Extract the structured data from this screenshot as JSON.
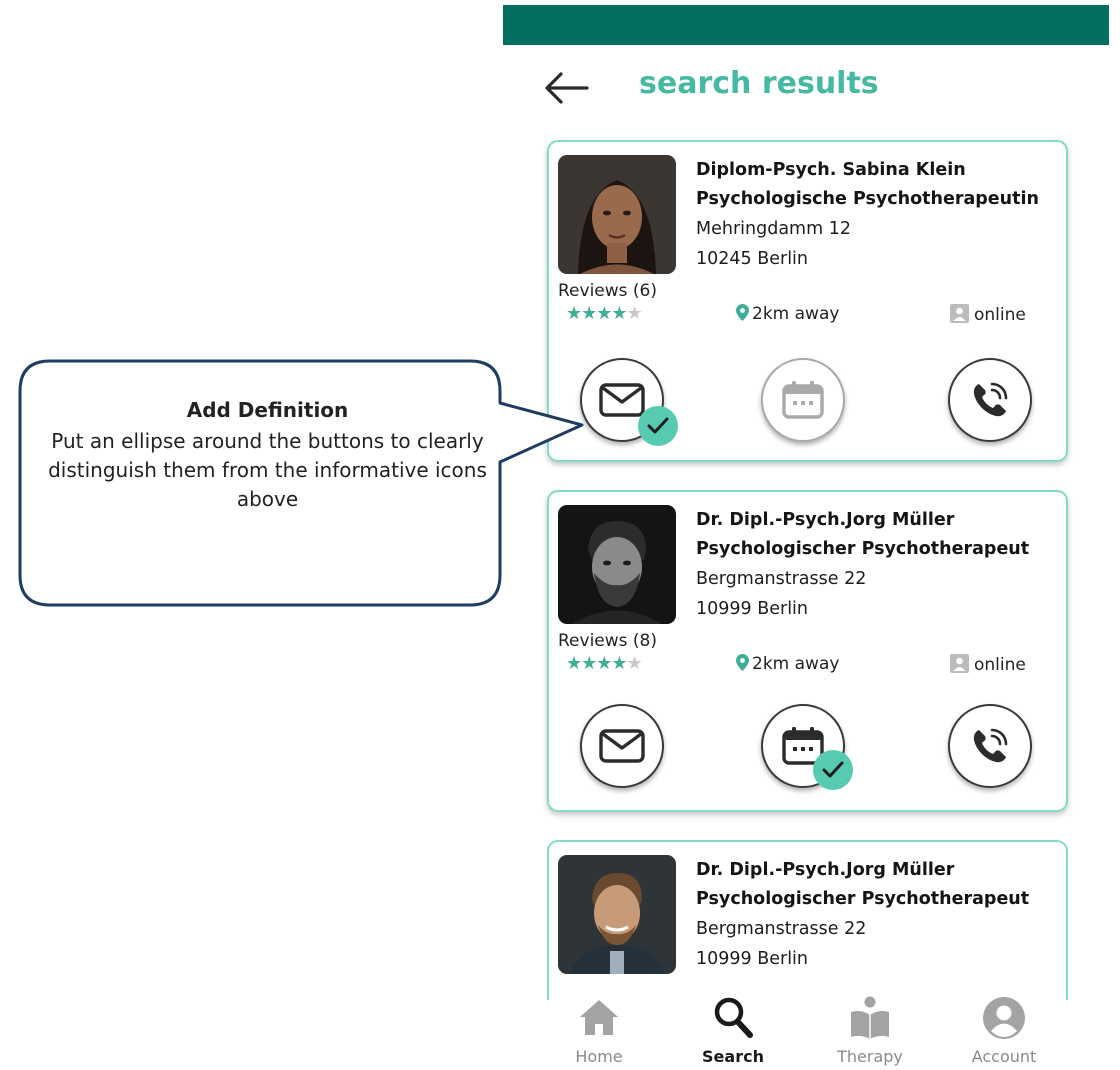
{
  "header": {
    "title": "search results"
  },
  "callout": {
    "heading": "Add Definition",
    "body": "Put an ellipse around the buttons to clearly distinguish them from the informative icons above"
  },
  "results": [
    {
      "name": "Diplom-Psych. Sabina Klein",
      "role": "Psychologische Psychotherapeutin",
      "street": "Mehringdamm 12",
      "city": "10245 Berlin",
      "reviews": "Reviews (6)",
      "rating": 4,
      "distance": "2km away",
      "availability": "online"
    },
    {
      "name": "Dr. Dipl.-Psych.Jorg Müller",
      "role": "Psychologischer Psychotherapeut",
      "street": "Bergmanstrasse 22",
      "city": "10999 Berlin",
      "reviews": "Reviews (8)",
      "rating": 4,
      "distance": "2km away",
      "availability": "online"
    },
    {
      "name": "Dr. Dipl.-Psych.Jorg Müller",
      "role": "Psychologischer Psychotherapeut",
      "street": "Bergmanstrasse 22",
      "city": "10999 Berlin"
    }
  ],
  "nav": {
    "home": "Home",
    "search": "Search",
    "therapy": "Therapy",
    "account": "Account"
  },
  "colors": {
    "topbar": "#016f5d",
    "accent": "#46b9a2",
    "card_border": "#7fdcc7",
    "check": "#56cbb1",
    "callout_border": "#1f3d63"
  },
  "icons": {
    "back": "arrow-left-icon",
    "message": "envelope-icon",
    "appointment": "calendar-icon",
    "call": "phone-icon",
    "distance": "map-pin-icon",
    "online": "person-square-icon"
  }
}
